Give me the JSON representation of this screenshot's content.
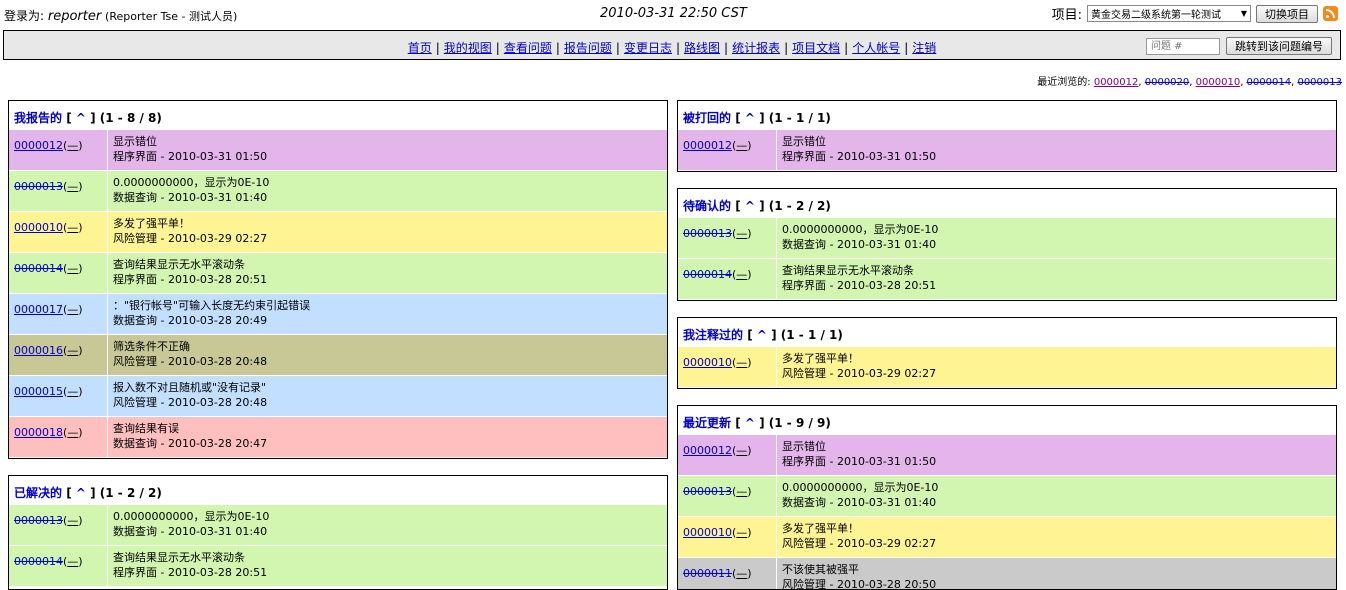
{
  "header": {
    "login_label": "登录为:",
    "username": "reporter",
    "fullname": "(Reporter Tse - 测试人员)",
    "datetime": "2010-03-31 22:50 CST",
    "project_label": "项目:",
    "project_selected": "黄金交易二级系统第一轮测试",
    "switch_button": "切换项目"
  },
  "nav": {
    "links": [
      "首页",
      "我的视图",
      "查看问题",
      "报告问题",
      "变更日志",
      "路线图",
      "统计报表",
      "项目文档",
      "个人帐号",
      "注销"
    ],
    "separator": "|",
    "jump_placeholder": "问题 #",
    "jump_button": "跳转到该问题编号"
  },
  "recent": {
    "label": "最近浏览的:",
    "items": [
      {
        "id": "0000012",
        "resolved": false
      },
      {
        "id": "0000020",
        "resolved": true
      },
      {
        "id": "0000010",
        "resolved": false
      },
      {
        "id": "0000014",
        "resolved": true
      },
      {
        "id": "0000013",
        "resolved": true
      }
    ]
  },
  "panels": {
    "reported": {
      "title": "我报告的",
      "up": "^",
      "count": "(1 - 8 / 8)",
      "rows": [
        {
          "id": "0000012",
          "closed": false,
          "color": "purple",
          "summary": "显示错位",
          "meta": "程序界面 - 2010-03-31 01:50"
        },
        {
          "id": "0000013",
          "closed": true,
          "color": "green",
          "summary": "0.0000000000，显示为0E-10",
          "meta": "数据查询 - 2010-03-31 01:40"
        },
        {
          "id": "0000010",
          "closed": false,
          "color": "yellow",
          "summary": "多发了强平单！",
          "meta": "风险管理 - 2010-03-29 02:27"
        },
        {
          "id": "0000014",
          "closed": true,
          "color": "green",
          "summary": "查询结果显示无水平滚动条",
          "meta": "程序界面 - 2010-03-28 20:51"
        },
        {
          "id": "0000017",
          "closed": false,
          "color": "blue",
          "summary": "：\"银行帐号\"可输入长度无约束引起错误",
          "meta": "数据查询 - 2010-03-28 20:49"
        },
        {
          "id": "0000016",
          "closed": false,
          "color": "olive2",
          "summary": "筛选条件不正确",
          "meta": "风险管理 - 2010-03-28 20:48"
        },
        {
          "id": "0000015",
          "closed": false,
          "color": "blue",
          "summary": "报入数不对且随机或\"没有记录\"",
          "meta": "风险管理 - 2010-03-28 20:48"
        },
        {
          "id": "0000018",
          "closed": false,
          "color": "red",
          "summary": "查询结果有误",
          "meta": "数据查询 - 2010-03-28 20:47"
        }
      ]
    },
    "resolved": {
      "title": "已解决的",
      "up": "^",
      "count": "(1 - 2 / 2)",
      "rows": [
        {
          "id": "0000013",
          "closed": true,
          "color": "green",
          "summary": "0.0000000000，显示为0E-10",
          "meta": "数据查询 - 2010-03-31 01:40"
        },
        {
          "id": "0000014",
          "closed": true,
          "color": "green",
          "summary": "查询结果显示无水平滚动条",
          "meta": "程序界面 - 2010-03-28 20:51"
        }
      ]
    },
    "feedback": {
      "title": "被打回的",
      "up": "^",
      "count": "(1 - 1 / 1)",
      "rows": [
        {
          "id": "0000012",
          "closed": false,
          "color": "purple",
          "summary": "显示错位",
          "meta": "程序界面 - 2010-03-31 01:50"
        }
      ]
    },
    "verify": {
      "title": "待确认的",
      "up": "^",
      "count": "(1 - 2 / 2)",
      "rows": [
        {
          "id": "0000013",
          "closed": true,
          "color": "green",
          "summary": "0.0000000000，显示为0E-10",
          "meta": "数据查询 - 2010-03-31 01:40"
        },
        {
          "id": "0000014",
          "closed": true,
          "color": "green",
          "summary": "查询结果显示无水平滚动条",
          "meta": "程序界面 - 2010-03-28 20:51"
        }
      ]
    },
    "monitored": {
      "title": "我注释过的",
      "up": "^",
      "count": "(1 - 1 / 1)",
      "rows": [
        {
          "id": "0000010",
          "closed": false,
          "color": "yellow",
          "summary": "多发了强平单！",
          "meta": "风险管理 - 2010-03-29 02:27"
        }
      ]
    },
    "recent_mod": {
      "title": "最近更新",
      "up": "^",
      "count": "(1 - 9 / 9)",
      "rows": [
        {
          "id": "0000012",
          "closed": false,
          "color": "purple",
          "summary": "显示错位",
          "meta": "程序界面 - 2010-03-31 01:50"
        },
        {
          "id": "0000013",
          "closed": true,
          "color": "green",
          "summary": "0.0000000000，显示为0E-10",
          "meta": "数据查询 - 2010-03-31 01:40"
        },
        {
          "id": "0000010",
          "closed": false,
          "color": "yellow",
          "summary": "多发了强平单！",
          "meta": "风险管理 - 2010-03-29 02:27"
        },
        {
          "id": "0000011",
          "closed": true,
          "color": "gray",
          "summary": "不该使其被强平",
          "meta": "风险管理 - 2010-03-28 20:50"
        }
      ]
    }
  },
  "colors": {
    "purple": "#e3b5eb",
    "green": "#d2f5b0",
    "yellow": "#fff494",
    "blue": "#c2dfff",
    "olive2": "#c8c896",
    "red": "#ffbfbf",
    "gray": "#cacaca",
    "link": "#0000cc"
  },
  "icons": {
    "rss": "rss-feed-icon",
    "dropdown": "chevron-down-icon"
  }
}
